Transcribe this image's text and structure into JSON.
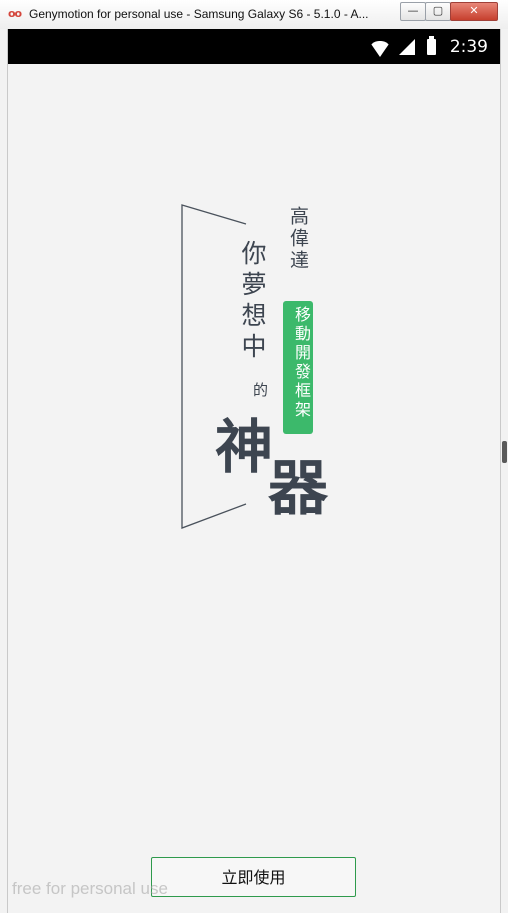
{
  "window": {
    "title": "Genymotion for personal use - Samsung Galaxy S6 - 5.1.0 - A...",
    "logo_text": "oo",
    "minimize_glyph": "—",
    "maximize_glyph": "▢",
    "close_glyph": "✕"
  },
  "statusbar": {
    "time": "2:39",
    "icons": [
      "wifi-icon",
      "cell-signal-icon",
      "battery-icon"
    ]
  },
  "splash": {
    "brand_line": "高偉達",
    "tagline": "你夢想中",
    "connector": "的",
    "badge_text": "移動開發框架",
    "big_char_1": "神",
    "big_char_2": "器",
    "accent_color": "#3cb96b",
    "text_color": "#3d4550"
  },
  "actions": {
    "start_label": "立即使用"
  },
  "watermark": "free for personal use"
}
